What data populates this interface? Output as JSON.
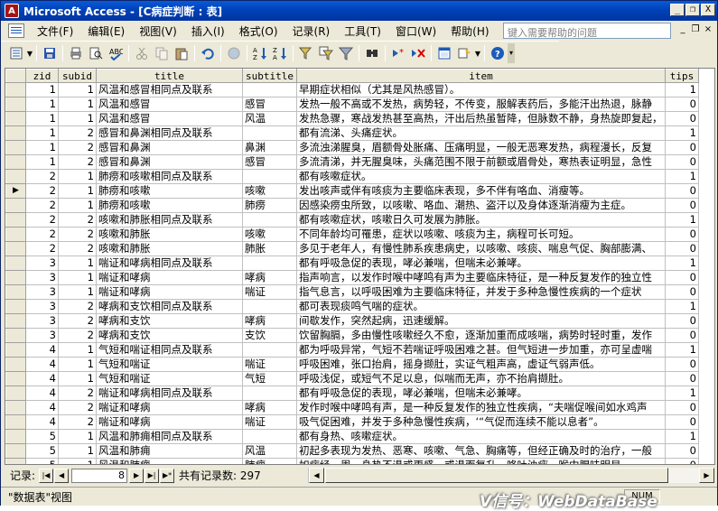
{
  "window": {
    "title": "Microsoft Access - [C病症判断 : 表]",
    "app_icon_letter": "A"
  },
  "title_controls": {
    "minimize": "_",
    "restore": "❐",
    "close": "X"
  },
  "menubar": {
    "items": [
      "文件(F)",
      "编辑(E)",
      "视图(V)",
      "插入(I)",
      "格式(O)",
      "记录(R)",
      "工具(T)",
      "窗口(W)",
      "帮助(H)"
    ],
    "help_placeholder": "键入需要帮助的问题",
    "doc_controls": {
      "minimize": "_",
      "restore": "❐",
      "close": "×"
    }
  },
  "toolbar": {
    "icons": [
      "view-icon",
      "save-icon",
      "print-icon",
      "print-preview-icon",
      "spelling-icon",
      "cut-icon",
      "copy-icon",
      "paste-icon",
      "undo-icon",
      "hyperlink-icon",
      "sort-ascending-icon",
      "sort-descending-icon",
      "filter-by-selection-icon",
      "filter-by-form-icon",
      "apply-filter-icon",
      "find-icon",
      "new-record-icon",
      "delete-record-icon",
      "database-window-icon",
      "new-object-icon",
      "help-icon"
    ]
  },
  "grid": {
    "columns": [
      "zid",
      "subid",
      "title",
      "subtitle",
      "item",
      "tips"
    ],
    "current_row": 7,
    "rows": [
      [
        "1",
        "1",
        "风温和感冒相同点及联系",
        "",
        "早期症状相似（尤其是风热感冒）。",
        "1"
      ],
      [
        "1",
        "1",
        "风温和感冒",
        "感冒",
        "发热一般不高或不发热，病势轻，不传变，服解表药后，多能汗出热退，脉静",
        "0"
      ],
      [
        "1",
        "1",
        "风温和感冒",
        "风温",
        "发热急骤，寒战发热甚至高热，汗出后热虽暂降，但脉数不静，身热旋即复起，",
        "0"
      ],
      [
        "1",
        "2",
        "感冒和鼻渊相同点及联系",
        "",
        "都有流涕、头痛症状。",
        "1"
      ],
      [
        "1",
        "2",
        "感冒和鼻渊",
        "鼻渊",
        "多流浊涕腥臭，眉额骨处胀痛、压痛明显，一般无恶寒发热，病程漫长，反复",
        "0"
      ],
      [
        "1",
        "2",
        "感冒和鼻渊",
        "感冒",
        "多流清涕，并无腥臭味，头痛范围不限于前额或眉骨处，寒热表证明显，急性",
        "0"
      ],
      [
        "2",
        "1",
        "肺痨和咳嗽相同点及联系",
        "",
        "都有咳嗽症状。",
        "1"
      ],
      [
        "2",
        "1",
        "肺痨和咳嗽",
        "咳嗽",
        "发出咳声或伴有咳痰为主要临床表现，多不伴有咯血、消瘦等。",
        "0"
      ],
      [
        "2",
        "1",
        "肺痨和咳嗽",
        "肺痨",
        "因感染痨虫所致，以咳嗽、咯血、潮热、盗汗以及身体逐渐消瘦为主症。",
        "0"
      ],
      [
        "2",
        "2",
        "咳嗽和肺胀相同点及联系",
        "",
        "都有咳嗽症状，咳嗽日久可发展为肺胀。",
        "1"
      ],
      [
        "2",
        "2",
        "咳嗽和肺胀",
        "咳嗽",
        "不同年龄均可罹患，症状以咳嗽、咳痰为主，病程可长可短。",
        "0"
      ],
      [
        "2",
        "2",
        "咳嗽和肺胀",
        "肺胀",
        "多见于老年人，有慢性肺系疾患病史，以咳嗽、咳痰、喘息气促、胸部膨满、",
        "0"
      ],
      [
        "3",
        "1",
        "喘证和哮病相同点及联系",
        "",
        "都有呼吸急促的表现，哮必兼喘，但喘未必兼哮。",
        "1"
      ],
      [
        "3",
        "1",
        "喘证和哮病",
        "哮病",
        "指声响言，以发作时喉中哮鸣有声为主要临床特征，是一种反复发作的独立性",
        "0"
      ],
      [
        "3",
        "1",
        "喘证和哮病",
        "喘证",
        "指气息言，以呼吸困难为主要临床特征，并发于多种急慢性疾病的一个症状",
        "0"
      ],
      [
        "3",
        "2",
        "哮病和支饮相同点及联系",
        "",
        "都可表现痰鸣气喘的症状。",
        "1"
      ],
      [
        "3",
        "2",
        "哮病和支饮",
        "哮病",
        "间歇发作，突然起病，迅速缓解。",
        "0"
      ],
      [
        "3",
        "2",
        "哮病和支饮",
        "支饮",
        "饮留胸膈，多由慢性咳嗽经久不愈，逐渐加重而成咳喘，病势时轻时重，发作",
        "0"
      ],
      [
        "4",
        "1",
        "气短和喘证相同点及联系",
        "",
        "都为呼吸异常，气短不若喘证呼吸困难之甚。但气短进一步加重，亦可呈虚喘",
        "1"
      ],
      [
        "4",
        "1",
        "气短和喘证",
        "喘证",
        "呼吸困难，张口抬肩，摇身撷肚，实证气粗声高，虚证气弱声低。",
        "0"
      ],
      [
        "4",
        "1",
        "气短和喘证",
        "气短",
        "呼吸浅促，或短气不足以息，似喘而无声，亦不抬肩撷肚。",
        "0"
      ],
      [
        "4",
        "2",
        "喘证和哮病相同点及联系",
        "",
        "都有呼吸急促的表现，哮必兼喘，但喘未必兼哮。",
        "1"
      ],
      [
        "4",
        "2",
        "喘证和哮病",
        "哮病",
        "发作时喉中哮鸣有声，是一种反复发作的独立性疾病，“夫喘促喉间如水鸡声",
        "0"
      ],
      [
        "4",
        "2",
        "喘证和哮病",
        "喘证",
        "吸气促困难，并发于多种急慢性疾病，‘“气促而连续不能以息者”。",
        "0"
      ],
      [
        "5",
        "1",
        "风温和肺痈相同点及联系",
        "",
        "都有身热、咳嗽症状。",
        "1"
      ],
      [
        "5",
        "1",
        "风温和肺痈",
        "风温",
        "初起多表现为发热、恶寒、咳嗽、气急、胸痛等，但经正确及时的治疗，一般",
        "0"
      ],
      [
        "5",
        "1",
        "风温和肺痈",
        "肺痈",
        "如病经一周，身热不退或更盛，或退而复升，咯吐浊痰，喉中腥味明显",
        "0"
      ]
    ]
  },
  "navigator": {
    "label": "记录:",
    "current": "8",
    "total_label": "共有记录数: 297",
    "first": "|◀",
    "prev": "◀",
    "next": "▶",
    "last": "▶|",
    "new": "▶*"
  },
  "statusbar": {
    "text": "\"数据表\"视图",
    "mode": "NUM"
  },
  "watermark": "V信号：WebDataBase"
}
